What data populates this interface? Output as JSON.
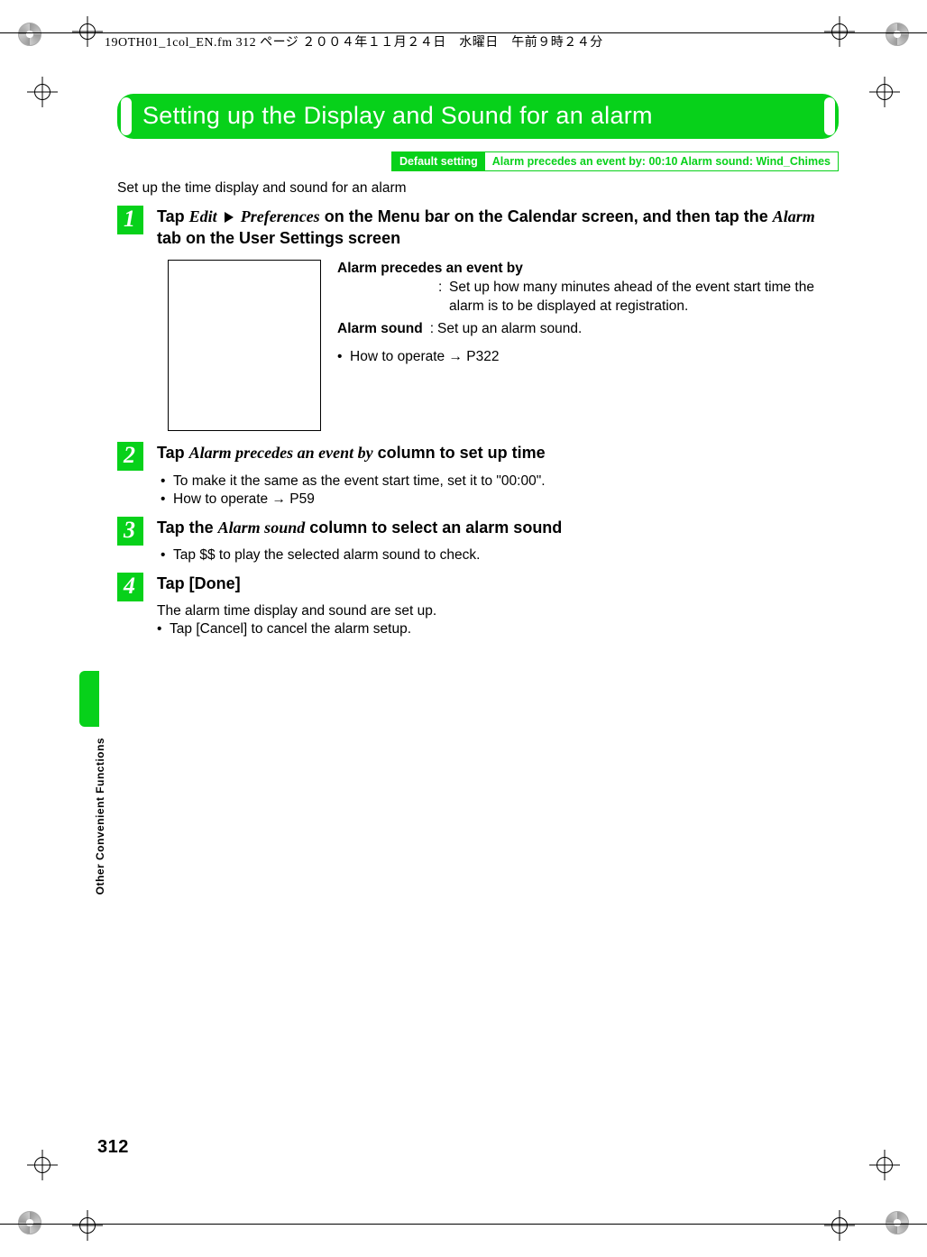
{
  "running_header": "19OTH01_1col_EN.fm  312 ページ  ２００４年１１月２４日　水曜日　午前９時２４分",
  "title": "Setting up the Display and Sound for an alarm",
  "default_setting": {
    "label": "Default setting",
    "value": "Alarm precedes an event by: 00:10 Alarm sound: Wind_Chimes"
  },
  "intro": "Set up the time display and sound for an alarm",
  "steps": {
    "s1": {
      "num": "1",
      "title_pre": "Tap ",
      "title_edit": "Edit",
      "title_prefs": "Preferences",
      "title_mid": " on the Menu bar on the Calendar screen, and then tap the ",
      "title_alarm": "Alarm",
      "title_end": " tab on the User Settings screen",
      "defs": {
        "precedes_term": "Alarm precedes an event by",
        "precedes_desc": "Set up how many minutes ahead of the event start time the alarm is to be displayed at registration.",
        "sound_term": "Alarm sound",
        "sound_desc": "Set up an alarm sound.",
        "howto": "How to operate → P322"
      }
    },
    "s2": {
      "num": "2",
      "title_pre": "Tap ",
      "title_ital": "Alarm precedes an event by",
      "title_end": " column to set up time",
      "bullet1": "To make it the same as the event start time, set it to \"00:00\".",
      "bullet2": "How to operate → P59"
    },
    "s3": {
      "num": "3",
      "title_pre": "Tap the ",
      "title_ital": "Alarm sound",
      "title_end": " column to select an alarm sound",
      "bullet1": "Tap $$ to play the selected alarm sound to check."
    },
    "s4": {
      "num": "4",
      "title": "Tap [Done]",
      "result": "The alarm time display and sound are set up.",
      "bullet1": "Tap [Cancel] to cancel the alarm setup."
    }
  },
  "side_label": "Other Convenient Functions",
  "page_number": "312"
}
